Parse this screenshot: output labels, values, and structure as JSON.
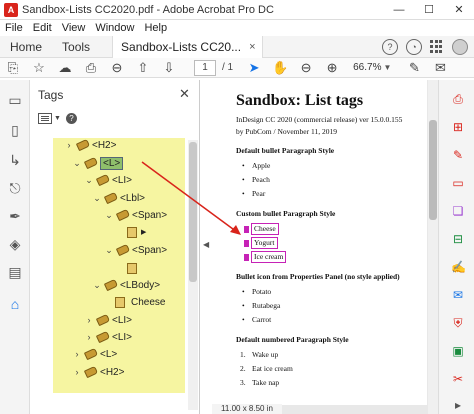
{
  "window": {
    "title": "Sandbox-Lists CC2020.pdf - Adobe Acrobat Pro DC",
    "minimize": "—",
    "maximize": "☐",
    "close": "✕"
  },
  "menu": [
    "File",
    "Edit",
    "View",
    "Window",
    "Help"
  ],
  "tabs": {
    "home": "Home",
    "tools": "Tools",
    "document": "Sandbox-Lists CC20...",
    "close": "×"
  },
  "toolbar": {
    "page_current": "1",
    "page_total": "/ 1",
    "zoom": "66.7%"
  },
  "tags_panel": {
    "title": "Tags",
    "close": "✕",
    "tree": [
      {
        "label": "<H2>",
        "expanded": false,
        "depth": 0
      },
      {
        "label": "<L>",
        "expanded": true,
        "depth": 0,
        "selected": true
      },
      {
        "label": "<LI>",
        "expanded": true,
        "depth": 1
      },
      {
        "label": "<Lbl>",
        "expanded": true,
        "depth": 2
      },
      {
        "label": "<Span>",
        "expanded": true,
        "depth": 3
      },
      {
        "label": "<Span>",
        "expanded": true,
        "depth": 3
      },
      {
        "label": "<LBody>",
        "expanded": true,
        "depth": 2
      },
      {
        "label": "Cheese",
        "content": true,
        "depth": 3
      },
      {
        "label": "<LI>",
        "expanded": false,
        "depth": 1
      },
      {
        "label": "<LI>",
        "expanded": false,
        "depth": 1
      },
      {
        "label": "<L>",
        "expanded": false,
        "depth": 0
      },
      {
        "label": "<H2>",
        "expanded": false,
        "depth": 0
      }
    ]
  },
  "document": {
    "title": "Sandbox: List tags",
    "meta1": "InDesign CC 2020 (commercial release) ver 15.0.0.155",
    "meta2": "by PubCom / November 11, 2019",
    "sections": [
      {
        "heading": "Default bullet Paragraph Style",
        "style": "bullet",
        "items": [
          "Apple",
          "Peach",
          "Pear"
        ]
      },
      {
        "heading": "Custom bullet Paragraph Style",
        "style": "magenta",
        "items": [
          "Cheese",
          "Yogurt",
          "Ice cream"
        ]
      },
      {
        "heading": "Bullet icon from Properties Panel (no style applied)",
        "style": "plain",
        "items": [
          "Potato",
          "Rutabega",
          "Carrot"
        ]
      },
      {
        "heading": "Default numbered Paragraph Style",
        "style": "num",
        "items": [
          "Wake up",
          "Eat ice cream",
          "Take nap"
        ]
      }
    ],
    "page_size": "11.00 x 8.50 in"
  },
  "colors": {
    "highlight": "#f6f5a1",
    "arrow": "#d9241b",
    "tag_outline": "#c622b6"
  }
}
